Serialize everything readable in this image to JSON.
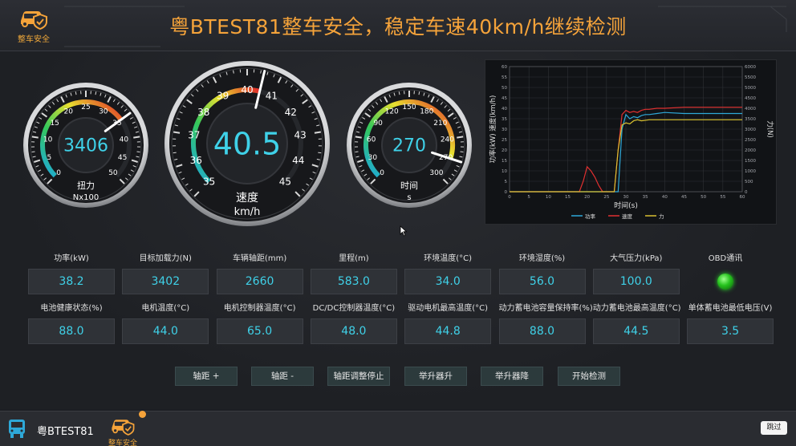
{
  "header": {
    "logo_label": "整车安全",
    "title": "粤BTEST81整车安全，稳定车速40km/h继续检测"
  },
  "gauges": {
    "torque": {
      "value": "3406",
      "label": "扭力",
      "unit": "Nx100",
      "ticks": [
        "0",
        "5",
        "10",
        "15",
        "20",
        "25",
        "30",
        "35",
        "40",
        "45",
        "50"
      ],
      "needle_value": 35,
      "max": 50
    },
    "speed": {
      "value": "40.5",
      "label": "速度",
      "unit": "km/h",
      "ticks": [
        "35",
        "36",
        "37",
        "38",
        "39",
        "40",
        "41",
        "42",
        "43",
        "44",
        "45"
      ],
      "needle_value": 40.5,
      "min": 35,
      "max": 45
    },
    "time": {
      "value": "270",
      "label": "时间",
      "unit": "s",
      "ticks": [
        "0",
        "30",
        "60",
        "90",
        "120",
        "150",
        "180",
        "210",
        "240",
        "270",
        "300"
      ],
      "needle_value": 270,
      "max": 300
    }
  },
  "chart_data": {
    "type": "line",
    "xlabel": "时间(s)",
    "ylabel_left": "功率(kW) 速度(km/h)",
    "ylabel_right": "力(N)",
    "xlim": [
      0,
      60
    ],
    "ylim_left": [
      0,
      60
    ],
    "ylim_right": [
      0,
      6000
    ],
    "x_ticks": [
      "0",
      "5",
      "10",
      "15",
      "20",
      "25",
      "30",
      "35",
      "40",
      "45",
      "50",
      "55",
      "60"
    ],
    "y_left_ticks": [
      "0",
      "5",
      "10",
      "15",
      "20",
      "25",
      "30",
      "35",
      "40",
      "45",
      "50",
      "55",
      "60"
    ],
    "y_right_ticks": [
      "0",
      "500",
      "1000",
      "1500",
      "2000",
      "2500",
      "3000",
      "3500",
      "4000",
      "4500",
      "5000",
      "5500",
      "6000"
    ],
    "grid": true,
    "legend_position": "bottom",
    "series": [
      {
        "name": "功率",
        "color": "#2ea8d8",
        "axis": "left",
        "x": [
          0,
          28,
          29,
          30,
          31,
          32,
          33,
          34,
          35,
          36,
          38,
          40,
          45,
          50,
          55,
          60
        ],
        "y": [
          0,
          0,
          30,
          37,
          35,
          36,
          35.5,
          36.5,
          37,
          37,
          37.5,
          38,
          37.5,
          37.5,
          37.5,
          37.5
        ]
      },
      {
        "name": "速度",
        "color": "#e03030",
        "axis": "left",
        "x": [
          0,
          18,
          19,
          20,
          21,
          22,
          23,
          24,
          25,
          27,
          28,
          29,
          30,
          31,
          32,
          33,
          34,
          35,
          36,
          38,
          40,
          45,
          50,
          55,
          60
        ],
        "y": [
          0,
          0,
          5,
          12,
          10,
          7,
          3,
          0,
          0,
          0,
          20,
          37,
          39,
          38,
          38.5,
          38,
          39,
          39.5,
          39.5,
          40,
          40,
          40.5,
          40.5,
          40.5,
          40.5
        ]
      },
      {
        "name": "力",
        "color": "#d8c030",
        "axis": "right",
        "x": [
          0,
          27,
          28,
          29,
          30,
          31,
          32,
          33,
          34,
          36,
          38,
          40,
          45,
          50,
          55,
          60
        ],
        "y": [
          0,
          0,
          2000,
          3200,
          3300,
          3250,
          3400,
          3450,
          3400,
          3450,
          3450,
          3450,
          3450,
          3450,
          3450,
          3450
        ]
      }
    ]
  },
  "params": {
    "row1": [
      {
        "label": "功率(kW)",
        "value": "38.2"
      },
      {
        "label": "目标加载力(N)",
        "value": "3402"
      },
      {
        "label": "车辆轴距(mm)",
        "value": "2660"
      },
      {
        "label": "里程(m)",
        "value": "583.0"
      },
      {
        "label": "环境温度(°C)",
        "value": "34.0"
      },
      {
        "label": "环境湿度(%)",
        "value": "56.0"
      },
      {
        "label": "大气压力(kPa)",
        "value": "100.0"
      }
    ],
    "obd_label": "OBD通讯",
    "obd_status_color": "#25c21d",
    "row2": [
      {
        "label": "电池健康状态(%)",
        "value": "88.0"
      },
      {
        "label": "电机温度(°C)",
        "value": "44.0"
      },
      {
        "label": "电机控制器温度(°C)",
        "value": "65.0"
      },
      {
        "label": "DC/DC控制器温度(°C)",
        "value": "48.0"
      },
      {
        "label": "驱动电机最高温度(°C)",
        "value": "44.8"
      },
      {
        "label": "动力蓄电池容量保持率(%)",
        "value": "88.0"
      },
      {
        "label": "动力蓄电池最高温度(°C)",
        "value": "44.5"
      },
      {
        "label": "单体蓄电池最低电压(V)",
        "value": "3.5"
      }
    ]
  },
  "buttons": {
    "wheelbase_plus": "轴距 +",
    "wheelbase_minus": "轴距 -",
    "wheelbase_stop": "轴距调整停止",
    "lift_up": "举升器升",
    "lift_down": "举升器降",
    "start_test": "开始检测"
  },
  "footer": {
    "car_id": "粤BTEST81",
    "tab_label": "整车安全",
    "skip_label": "跳过"
  },
  "colors": {
    "accent": "#f5a33a",
    "value_text": "#3fd1e8"
  }
}
